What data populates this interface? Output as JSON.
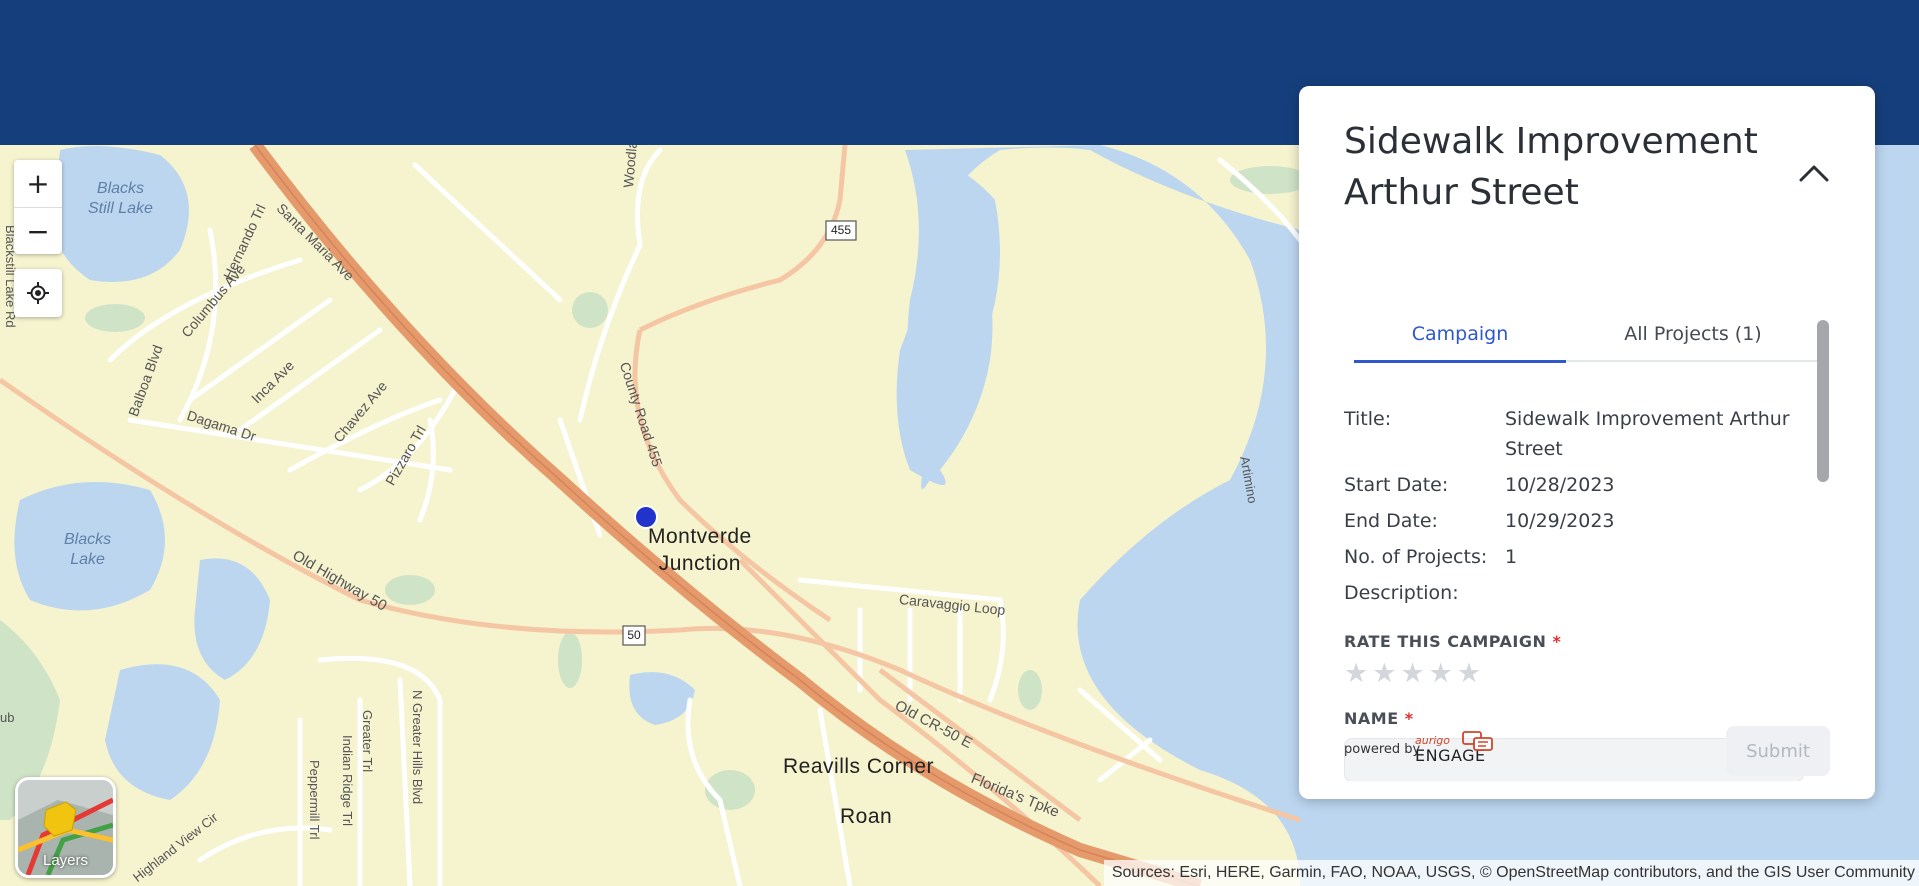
{
  "map": {
    "water_labels": [
      "Blacks\nStill Lake",
      "Blacks\nLake"
    ],
    "road_labels": [
      "Woodlands Dr",
      "Hernando Trl",
      "Santa Maria Ave",
      "Columbus Ave",
      "Balboa Blvd",
      "Inca Ave",
      "Chavez Ave",
      "Dagama Dr",
      "Pizzaro Trl",
      "County Road 455",
      "Old Highway 50",
      "Caravaggio Loop",
      "Old CR-50 E",
      "Florida's Tpke",
      "Greater Trl",
      "N Greater Hills Blvd",
      "Indian Ridge Trl",
      "Peppermill Trl",
      "Highland View Cir",
      "Blackstill Lake Rd",
      "Artimino",
      "ub"
    ],
    "shields": [
      "455",
      "50"
    ],
    "place_labels": [
      "Montverde\nJunction",
      "Reavills Corner",
      "Roan"
    ],
    "marker_color": "#2233cc"
  },
  "controls": {
    "zoom_in": "+",
    "zoom_out": "−",
    "layers_label": "Layers"
  },
  "attribution": "Sources: Esri, HERE, Garmin, FAO, NOAA, USGS, © OpenStreetMap contributors, and the GIS User Community",
  "panel": {
    "title": "Sidewalk Improvement Arthur Street",
    "tabs": [
      {
        "label": "Campaign",
        "active": true
      },
      {
        "label": "All Projects (1)",
        "active": false
      }
    ],
    "details": [
      {
        "label": "Title:",
        "value": "Sidewalk Improvement Arthur Street"
      },
      {
        "label": "Start Date:",
        "value": "10/28/2023"
      },
      {
        "label": "End Date:",
        "value": "10/29/2023"
      },
      {
        "label": "No. of Projects:",
        "value": "1"
      },
      {
        "label": "Description:",
        "value": ""
      }
    ],
    "rate_label": "RATE THIS CAMPAIGN",
    "rating": 0,
    "rating_max": 5,
    "name_label": "NAME",
    "required_mark": "*",
    "name_value": "",
    "powered_by": "powered by",
    "brand_small": "aurigo",
    "brand_big": "ENGAGE",
    "submit_label": "Submit"
  },
  "colors": {
    "header": "#153f7c",
    "land": "#f6f3cf",
    "water": "#bcd6f0",
    "highway": "#e59a6c",
    "accent": "#2f58cd",
    "required": "#e0312f"
  }
}
